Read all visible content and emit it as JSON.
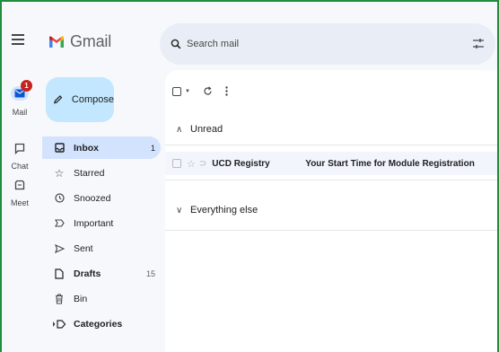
{
  "app": {
    "name": "Gmail"
  },
  "rail": {
    "items": [
      {
        "label": "Mail",
        "badge": "1"
      },
      {
        "label": "Chat"
      },
      {
        "label": "Meet"
      }
    ]
  },
  "compose": {
    "label": "Compose"
  },
  "sidebar": {
    "items": [
      {
        "label": "Inbox",
        "count": "1",
        "icon": "inbox-icon",
        "active": true,
        "bold": true
      },
      {
        "label": "Starred",
        "count": "",
        "icon": "star-icon"
      },
      {
        "label": "Snoozed",
        "count": "",
        "icon": "clock-icon"
      },
      {
        "label": "Important",
        "count": "",
        "icon": "important-icon"
      },
      {
        "label": "Sent",
        "count": "",
        "icon": "send-icon"
      },
      {
        "label": "Drafts",
        "count": "15",
        "icon": "draft-icon",
        "bold": true
      },
      {
        "label": "Bin",
        "count": "",
        "icon": "trash-icon"
      },
      {
        "label": "Categories",
        "count": "",
        "icon": "label-icon",
        "bold": true
      }
    ]
  },
  "search": {
    "placeholder": "Search mail"
  },
  "sections": [
    {
      "title": "Unread"
    },
    {
      "title": "Everything else"
    }
  ],
  "emails": [
    {
      "sender": "UCD Registry",
      "subject": "Your Start Time for Module Registration"
    }
  ],
  "colors": {
    "frame_border": "#1e8e3e",
    "background": "#f6f8fc",
    "compose": "#c2e7ff",
    "active_nav": "#d3e3fd",
    "badge": "#c5221f"
  }
}
